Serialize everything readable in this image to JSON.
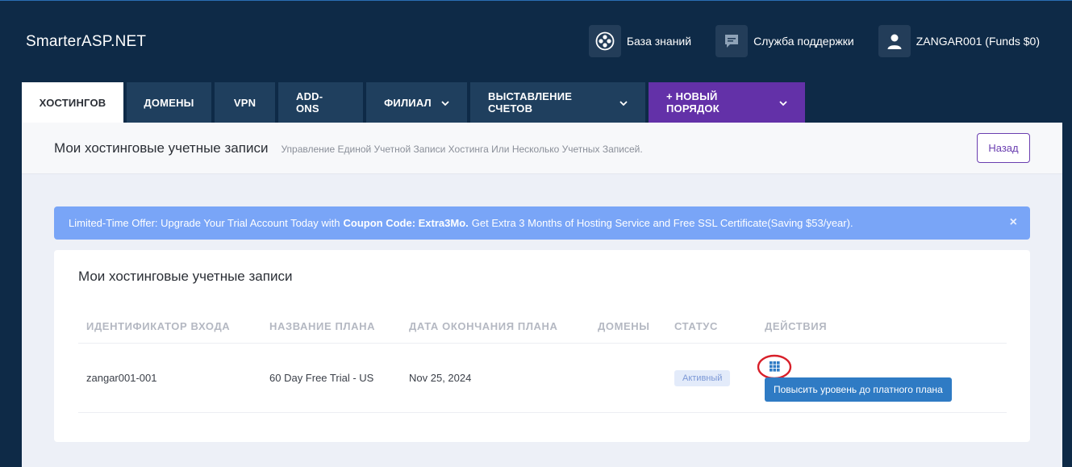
{
  "brand": "SmarterASP.NET",
  "top_links": {
    "knowledge": "База знаний",
    "support": "Служба поддержки",
    "account": "ZANGAR001 (Funds $0)"
  },
  "tabs": [
    {
      "label": "ХОСТИНГОВ"
    },
    {
      "label": "ДОМЕНЫ"
    },
    {
      "label": "VPN"
    },
    {
      "label": "ADD-ONS"
    },
    {
      "label": "ФИЛИАЛ"
    },
    {
      "label": "ВЫСТАВЛЕНИЕ СЧЕТОВ"
    },
    {
      "label": "+ НОВЫЙ ПОРЯДОК"
    }
  ],
  "header": {
    "title": "Мои хостинговые учетные записи",
    "subtitle": "Управление Единой Учетной Записи Хостинга Или Несколько Учетных Записей.",
    "back": "Назад"
  },
  "alert": {
    "text_before": "Limited-Time Offer: Upgrade Your Trial Account Today with",
    "bold": "Coupon Code: Extra3Mo.",
    "text_after": "Get Extra 3 Months of Hosting Service and Free SSL Certificate(Saving $53/year).",
    "close": "×"
  },
  "card": {
    "title": "Мои хостинговые учетные записи",
    "columns": [
      "ИДЕНТИФИКАТОР ВХОДА",
      "НАЗВАНИЕ ПЛАНА",
      "ДАТА ОКОНЧАНИЯ ПЛАНА",
      "ДОМЕНЫ",
      "СТАТУС",
      "ДЕЙСТВИЯ"
    ],
    "rows": [
      {
        "login": "zangar001-001",
        "plan": "60 Day Free Trial - US",
        "expires": "Nov 25, 2024",
        "domains": "",
        "status": "Активный"
      }
    ],
    "tooltip": "Повысить уровень до платного плана"
  },
  "colors": {
    "background": "#0e2a47",
    "tab": "#1f3f5e",
    "tab_new_order": "#6331a8",
    "alert": "#79a5f7",
    "tooltip": "#2f7bc4",
    "annotation": "#d8202a"
  }
}
